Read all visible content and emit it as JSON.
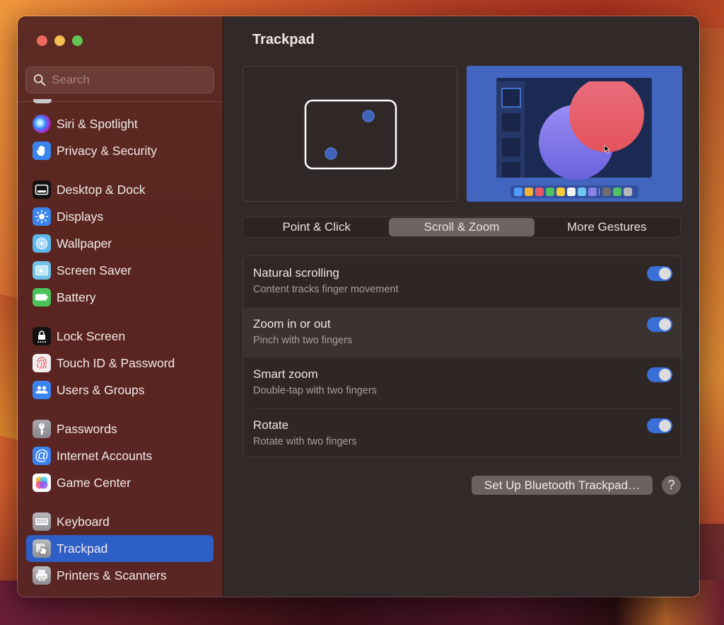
{
  "window": {
    "title": "Trackpad"
  },
  "sidebar": {
    "search": {
      "placeholder": "Search",
      "value": ""
    },
    "items": [
      {
        "label": "Siri & Spotlight",
        "icon": "siri-icon",
        "active": false
      },
      {
        "label": "Privacy & Security",
        "icon": "hand-icon",
        "active": false
      },
      {
        "label": "Desktop & Dock",
        "icon": "dock-icon",
        "active": false
      },
      {
        "label": "Displays",
        "icon": "sun-icon",
        "active": false
      },
      {
        "label": "Wallpaper",
        "icon": "flower-icon",
        "active": false
      },
      {
        "label": "Screen Saver",
        "icon": "screen-saver-icon",
        "active": false
      },
      {
        "label": "Battery",
        "icon": "battery-icon",
        "active": false
      },
      {
        "label": "Lock Screen",
        "icon": "lock-icon",
        "active": false
      },
      {
        "label": "Touch ID & Password",
        "icon": "fingerprint-icon",
        "active": false
      },
      {
        "label": "Users & Groups",
        "icon": "users-icon",
        "active": false
      },
      {
        "label": "Passwords",
        "icon": "key-icon",
        "active": false
      },
      {
        "label": "Internet Accounts",
        "icon": "at-icon",
        "active": false
      },
      {
        "label": "Game Center",
        "icon": "game-center-icon",
        "active": false
      },
      {
        "label": "Keyboard",
        "icon": "keyboard-icon",
        "active": false
      },
      {
        "label": "Trackpad",
        "icon": "trackpad-icon",
        "active": true
      },
      {
        "label": "Printers & Scanners",
        "icon": "printer-icon",
        "active": false
      }
    ]
  },
  "main": {
    "title": "Trackpad",
    "tabs": [
      {
        "label": "Point & Click",
        "active": false
      },
      {
        "label": "Scroll & Zoom",
        "active": true
      },
      {
        "label": "More Gestures",
        "active": false
      }
    ],
    "settings": [
      {
        "title": "Natural scrolling",
        "subtitle": "Content tracks finger movement",
        "enabled": true
      },
      {
        "title": "Zoom in or out",
        "subtitle": "Pinch with two fingers",
        "enabled": true
      },
      {
        "title": "Smart zoom",
        "subtitle": "Double-tap with two fingers",
        "enabled": true
      },
      {
        "title": "Rotate",
        "subtitle": "Rotate with two fingers",
        "enabled": true
      }
    ],
    "bluetooth_button": "Set Up Bluetooth Trackpad…",
    "help_button": "?"
  },
  "colors": {
    "accent": "#2e5fc7",
    "toggle_on": "#3a6fd8",
    "traffic_close": "#ec6a5e",
    "traffic_minimize": "#f4bf4f",
    "traffic_maximize": "#61c554"
  }
}
